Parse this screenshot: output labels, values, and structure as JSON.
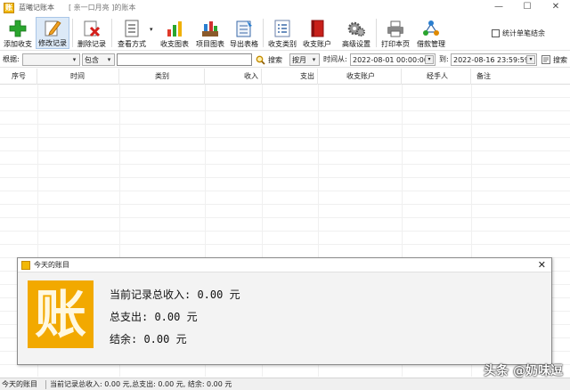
{
  "window": {
    "app_name": "蓝曦记账本",
    "book_name": "[ 亲一口月亮 ]的账本",
    "controls": [
      "—",
      "☐",
      "✕"
    ]
  },
  "toolbar": {
    "buttons": [
      {
        "label": "添加收支",
        "icon": "add-plus-icon"
      },
      {
        "label": "修改记录",
        "icon": "edit-pencil-icon"
      },
      {
        "label": "删除记录",
        "icon": "delete-x-icon"
      },
      {
        "label": "查看方式",
        "icon": "view-mode-icon"
      },
      {
        "label": "收支图表",
        "icon": "bar-chart-icon"
      },
      {
        "label": "项目图表",
        "icon": "project-chart-icon"
      },
      {
        "label": "导出表格",
        "icon": "export-table-icon"
      },
      {
        "label": "收支类别",
        "icon": "category-list-icon"
      },
      {
        "label": "收支账户",
        "icon": "account-book-icon"
      },
      {
        "label": "高级设置",
        "icon": "gear-icon"
      },
      {
        "label": "打印本页",
        "icon": "printer-icon"
      },
      {
        "label": "借款管理",
        "icon": "loan-network-icon"
      }
    ],
    "stat_single_checkbox": {
      "label": "统计单笔结余",
      "checked": false
    }
  },
  "filter": {
    "by_label": "根据:",
    "field_value": "",
    "match_value": "包含",
    "keyword_value": "",
    "search_label": "搜索",
    "period_value": "按月",
    "time_from_label": "时间从:",
    "time_from_value": "2022-08-01 00:00:00",
    "time_to_label": "到:",
    "time_to_value": "2022-08-16 23:59:59",
    "search2_label": "搜索"
  },
  "table": {
    "columns": [
      "序号",
      "时间",
      "类别",
      "收入",
      "支出",
      "收支账户",
      "经手人",
      "备注"
    ],
    "rows": []
  },
  "dialog": {
    "title": "今天的账目",
    "badge_char": "账",
    "total_income": "当前记录总收入: 0.00 元",
    "total_expense": "总支出: 0.00 元",
    "balance": "结余: 0.00 元"
  },
  "statusbar": {
    "label": "今天的账目",
    "summary": "当前记录总收入: 0.00 元,总支出: 0.00 元, 结余: 0.00 元"
  },
  "watermark": "头条 @奶味逗",
  "colors": {
    "accent_yellow": "#f2a900",
    "active_button_bg": "#dce9f7"
  }
}
